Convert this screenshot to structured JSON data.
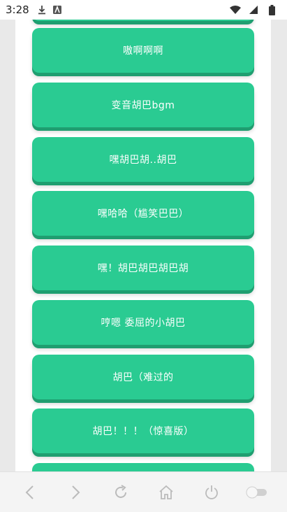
{
  "status_bar": {
    "time": "3:28"
  },
  "buttons": [
    "",
    "嗷啊啊啊",
    "变音胡巴bgm",
    "嘿胡巴胡..胡巴",
    "嘿哈哈（尴笑巴巴）",
    "嘿！胡巴胡巴胡巴胡",
    "哼嗯 委屈的小胡巴",
    "胡巴（难过的",
    "胡巴！！！（惊喜版）",
    ""
  ],
  "colors": {
    "button": "#2acb92",
    "button_shadow": "#1f9e70",
    "page_bg": "#ffffff",
    "frame_bg": "#e9e9e9"
  },
  "icons": {
    "status": [
      "download-icon",
      "app-icon",
      "wifi-icon",
      "signal-icon",
      "battery-icon"
    ],
    "nav": [
      "back-icon",
      "forward-icon",
      "reload-icon",
      "home-icon",
      "power-icon",
      "toggle-icon"
    ]
  }
}
